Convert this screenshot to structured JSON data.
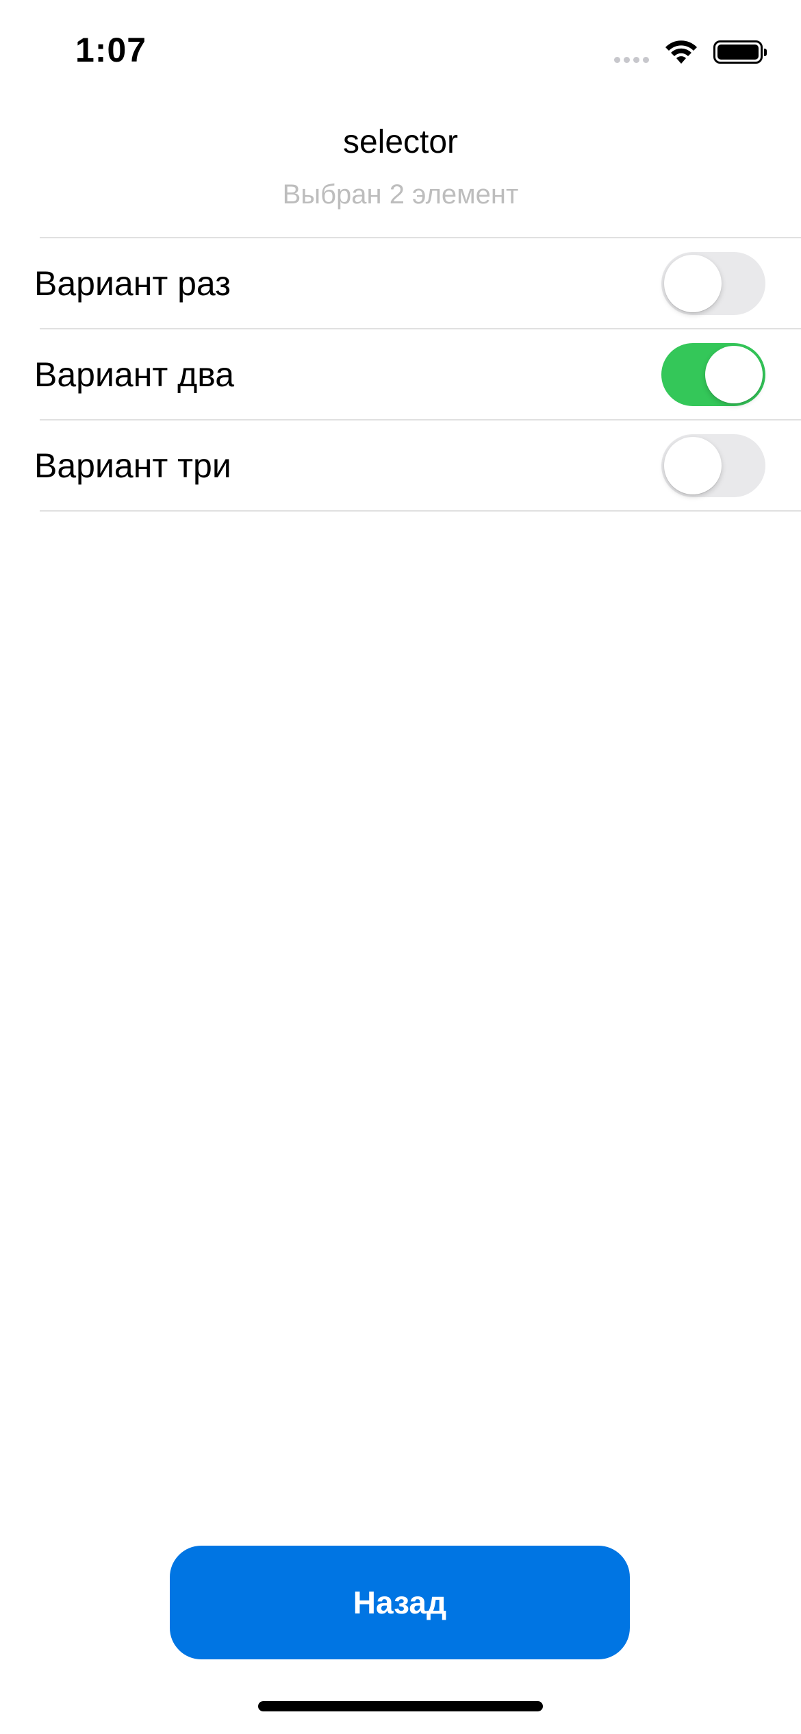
{
  "status_bar": {
    "time": "1:07",
    "icons": [
      "cellular-signal-icon",
      "wifi-icon",
      "battery-icon"
    ]
  },
  "header": {
    "title": "selector",
    "subtitle": "Выбран 2 элемент"
  },
  "options": [
    {
      "label": "Вариант раз",
      "checked": false
    },
    {
      "label": "Вариант два",
      "checked": true
    },
    {
      "label": "Вариант три",
      "checked": false
    }
  ],
  "colors": {
    "accent_button": "#0075e3",
    "toggle_on": "#34c759",
    "toggle_off": "#e9e9eb",
    "subtitle_text": "#bdbdbd"
  },
  "footer": {
    "back_label": "Назад"
  }
}
